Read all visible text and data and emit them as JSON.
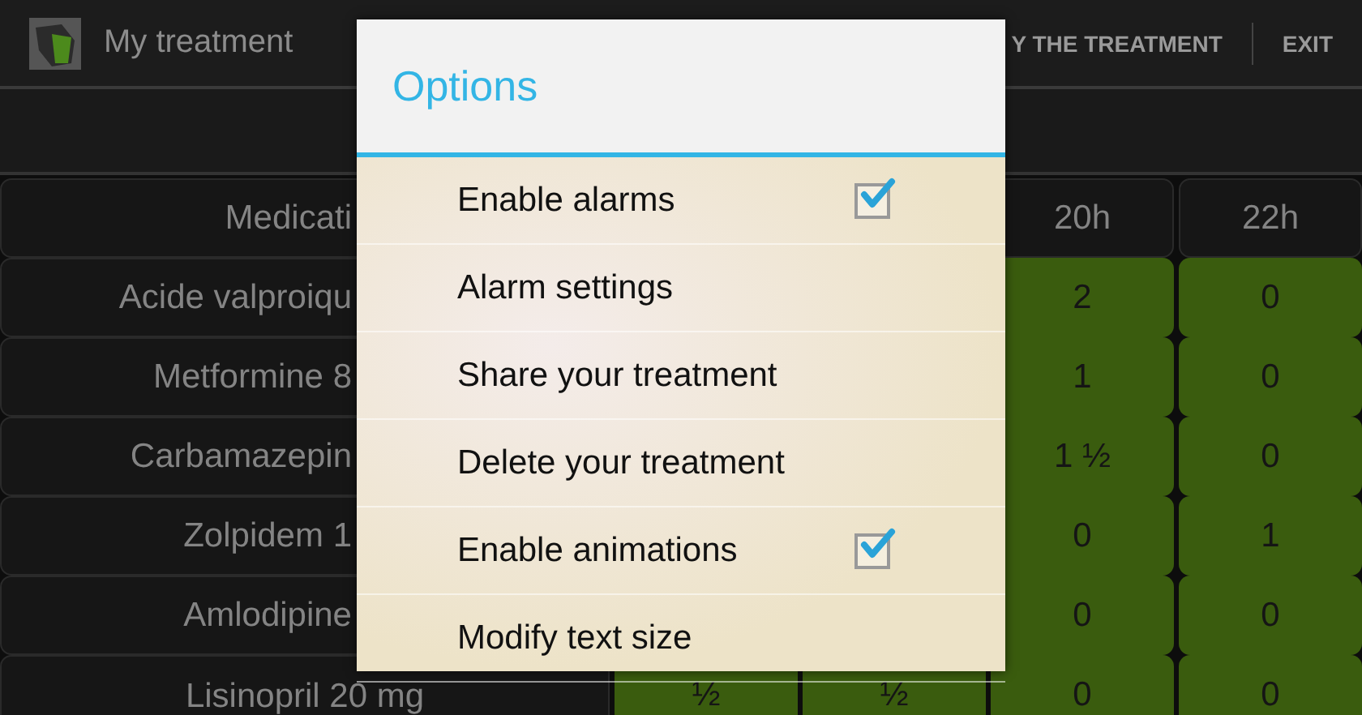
{
  "action_bar": {
    "title": "My treatment",
    "actions": [
      "Y THE TREATMENT",
      "EXIT"
    ]
  },
  "table": {
    "header": {
      "medication": "Medicati",
      "times": [
        "20h",
        "22h"
      ]
    },
    "rows": [
      {
        "name": "Acide valproiqu",
        "doses": [
          "2",
          "0"
        ]
      },
      {
        "name": "Metformine 8",
        "doses": [
          "1",
          "0"
        ]
      },
      {
        "name": "Carbamazepin",
        "doses": [
          "1 ½",
          "0"
        ]
      },
      {
        "name": "Zolpidem 1",
        "doses": [
          "0",
          "1"
        ]
      },
      {
        "name": "Amlodipine",
        "doses": [
          "0",
          "0"
        ]
      },
      {
        "name": "Lisinopril 20 mg",
        "doses": [
          "½",
          "½",
          "0",
          "0"
        ]
      }
    ]
  },
  "dialog": {
    "title": "Options",
    "items": [
      {
        "kind": "checkbox",
        "label": "Enable alarms",
        "checked": true
      },
      {
        "kind": "plain",
        "label": "Alarm settings"
      },
      {
        "kind": "plain",
        "label": "Share your treatment"
      },
      {
        "kind": "plain",
        "label": "Delete your treatment"
      },
      {
        "kind": "checkbox",
        "label": "Enable animations",
        "checked": true
      },
      {
        "kind": "plain",
        "label": "Modify text size"
      }
    ]
  }
}
